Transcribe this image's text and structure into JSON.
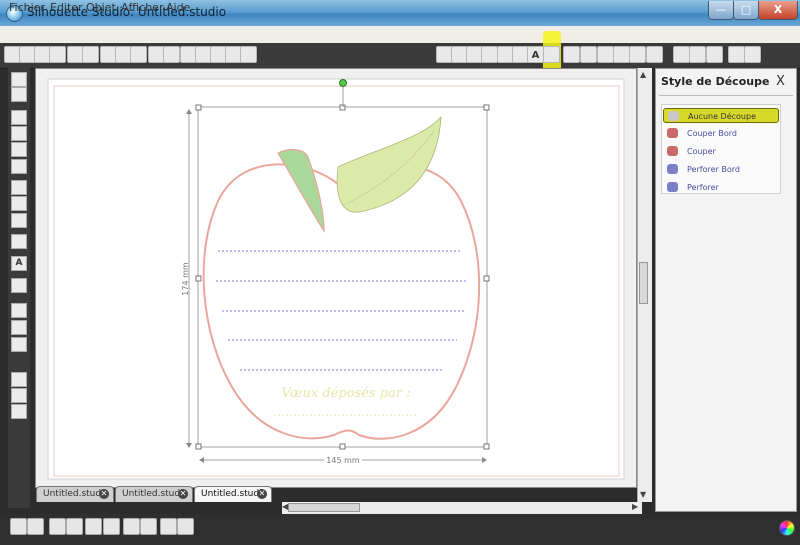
{
  "window": {
    "title": "Silhouette Studio: Untitled.studio",
    "minimize": "—",
    "maximize": "□",
    "close": "X"
  },
  "menu": [
    "Fichier",
    "Editer",
    "Objet",
    "Afficher",
    "Aide"
  ],
  "toolbar": {
    "icons": [
      "new-icon",
      "open-icon",
      "save-icon",
      "save-as-icon",
      "print-icon",
      "cut-to-silhouette-icon",
      "copy-icon",
      "paste-icon",
      "scissors-icon",
      "undo-icon",
      "redo-icon",
      "zoom-in-icon",
      "zoom-out-icon",
      "zoom-select-icon",
      "pan-icon",
      "fit-page-icon",
      "library-icon",
      "fill-color-icon",
      "line-color-icon",
      "line-style-icon",
      "line-style2-icon",
      "cut-style-icon",
      "text-style-icon",
      "transform-icon",
      "rotate-icon",
      "scale-icon",
      "move-icon",
      "replicate-icon",
      "store-icon",
      "design-page-icon",
      "registration-icon",
      "cut-settings-icon",
      "sketch-icon",
      "send-icon",
      "settings-icon"
    ],
    "highlighted": "cut-style-icon",
    "text_style_label": "A"
  },
  "left_tools": [
    "select-icon",
    "point-edit-icon",
    "line-icon",
    "rectangle-icon",
    "rounded-rect-icon",
    "ellipse-icon",
    "polygon-icon",
    "curve-icon",
    "arc-icon",
    "freehand-icon",
    "text-icon",
    "eraser-icon",
    "knife-icon",
    "page-setup-icon",
    "library-view-icon",
    "design-store-icon",
    "layer-icon",
    "panel-icon"
  ],
  "canvas": {
    "height_label": "174 mm",
    "width_label": "145 mm",
    "card_text": "Vœux déposés par :"
  },
  "tabs": [
    {
      "label": "Untitled.studio",
      "active": false
    },
    {
      "label": "Untitled.studio",
      "active": false
    },
    {
      "label": "Untitled.studio",
      "active": true
    }
  ],
  "panel": {
    "title": "Style de Découpe",
    "close": "X",
    "options": [
      {
        "label": "Aucune Découpe",
        "selected": true,
        "color": "#c8c8c8"
      },
      {
        "label": "Couper Bord",
        "selected": false,
        "color": "#c96a6a"
      },
      {
        "label": "Couper",
        "selected": false,
        "color": "#c96a6a"
      },
      {
        "label": "Perforer Bord",
        "selected": false,
        "color": "#7b7fc8"
      },
      {
        "label": "Perforer",
        "selected": false,
        "color": "#7b7fc8"
      }
    ]
  },
  "bottom_tools": [
    "group-icon",
    "ungroup-icon",
    "weld-icon",
    "subtract-icon",
    "intersect-icon",
    "crop-icon",
    "bring-front-icon",
    "send-back-icon",
    "offset-icon",
    "trace-icon",
    "color-wheel-icon"
  ],
  "colors": {
    "apple_outline": "#e9a79c",
    "leaf_fill": "#dde9a8",
    "stem_fill": "#a9d89a",
    "dotted_line": "#b9a0e6",
    "cut_line": "#f0c4c4",
    "highlight": "#f6f31a"
  }
}
